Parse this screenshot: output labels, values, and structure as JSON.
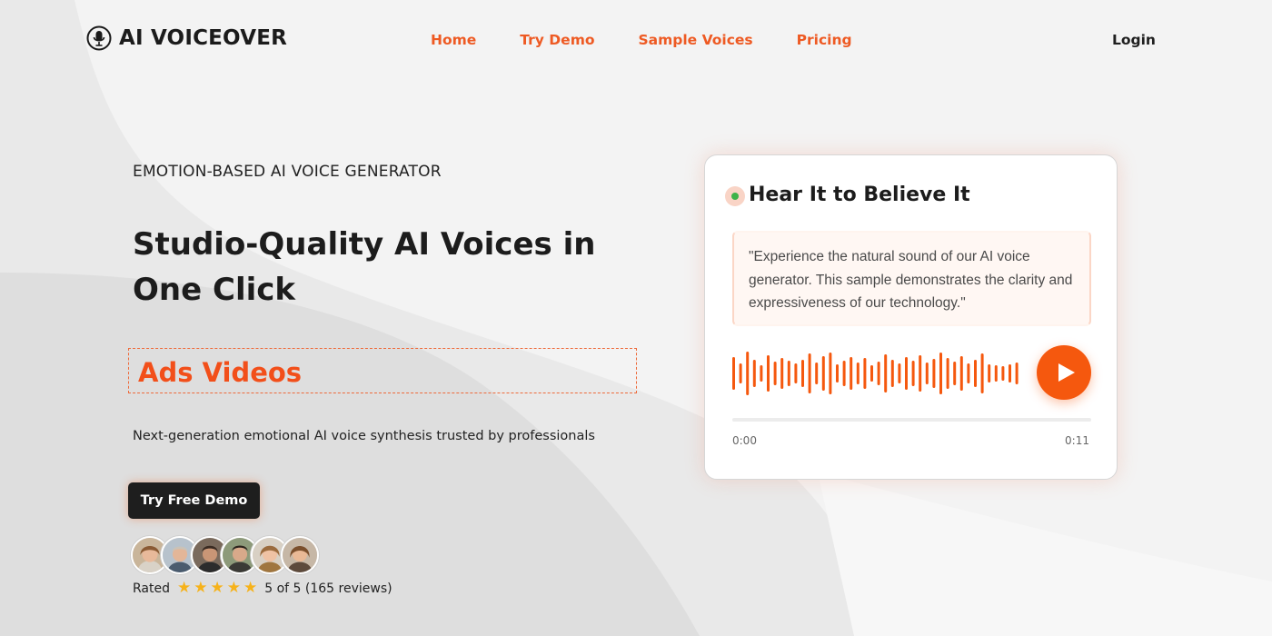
{
  "colors": {
    "accent": "#f5580e",
    "nav_link": "#ee5a23",
    "highlight_text": "#f24f1a",
    "dark": "#1e1e1e",
    "star": "#f6b21a",
    "status_dot": "#3db34a"
  },
  "nav": {
    "logo_text": "AI VOICEOVER",
    "logo_icon": "microphone-icon",
    "links": [
      "Home",
      "Try Demo",
      "Sample Voices",
      "Pricing"
    ],
    "login": "Login"
  },
  "hero": {
    "eyebrow": "EMOTION-BASED AI VOICE GENERATOR",
    "headline": "Studio-Quality AI Voices in One Click",
    "rotating_word": "Ads Videos",
    "subtext": "Next-generation emotional AI voice synthesis trusted by professionals",
    "cta": "Try Free Demo",
    "avatar_count": 6,
    "rating": {
      "prefix": "Rated",
      "stars": 5,
      "summary": "5 of 5 (165 reviews)"
    }
  },
  "card": {
    "title": "Hear It to Believe It",
    "quote": "\"Experience the natural sound of our AI voice generator. This sample demonstrates the clarity and expressiveness of our technology.\"",
    "time_start": "0:00",
    "time_end": "0:11",
    "progress": 0,
    "play_icon": "play-icon"
  }
}
